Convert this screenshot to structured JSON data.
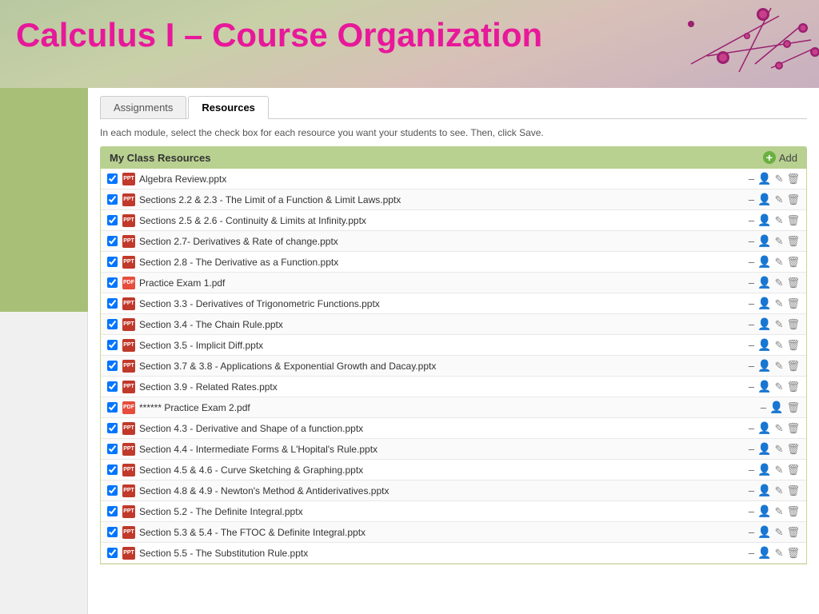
{
  "header": {
    "title": "Calculus I – Course Organization",
    "bg_color": "#c8d090"
  },
  "tabs": [
    {
      "id": "assignments",
      "label": "Assignments",
      "active": false
    },
    {
      "id": "resources",
      "label": "Resources",
      "active": true
    }
  ],
  "instruction": "In each module, select the check box for each resource you want your students to see. Then, click Save.",
  "resources_section": {
    "header": "My Class Resources",
    "add_label": "Add"
  },
  "resources": [
    {
      "name": "Algebra Review.pptx",
      "type": "pptx",
      "has_person": true
    },
    {
      "name": "Sections 2.2 & 2.3 - The Limit of a Function & Limit Laws.pptx",
      "type": "pptx",
      "has_person": true
    },
    {
      "name": "Sections 2.5 & 2.6 - Continuity & Limits at Infinity.pptx",
      "type": "pptx",
      "has_person": true
    },
    {
      "name": "Section 2.7- Derivatives & Rate of change.pptx",
      "type": "pptx",
      "has_person": true
    },
    {
      "name": "Section 2.8 - The Derivative as a Function.pptx",
      "type": "pptx",
      "has_person": true
    },
    {
      "name": "Practice Exam 1.pdf",
      "type": "pdf",
      "has_person": true
    },
    {
      "name": "Section 3.3 - Derivatives of Trigonometric Functions.pptx",
      "type": "pptx",
      "has_person": true
    },
    {
      "name": "Section 3.4 - The Chain Rule.pptx",
      "type": "pptx",
      "has_person": true
    },
    {
      "name": "Section 3.5 - Implicit Diff.pptx",
      "type": "pptx",
      "has_person": true
    },
    {
      "name": "Section 3.7 & 3.8 - Applications & Exponential Growth and Dacay.pptx",
      "type": "pptx",
      "has_person": true
    },
    {
      "name": "Section 3.9 - Related Rates.pptx",
      "type": "pptx",
      "has_person": true
    },
    {
      "name": "****** Practice Exam 2.pdf",
      "type": "pdf",
      "has_person": true
    },
    {
      "name": "Section 4.3 - Derivative and Shape of a function.pptx",
      "type": "pptx",
      "has_person": true
    },
    {
      "name": "Section 4.4 - Intermediate Forms & L'Hopital's Rule.pptx",
      "type": "pptx",
      "has_person": true
    },
    {
      "name": "Section 4.5 & 4.6 - Curve Sketching & Graphing.pptx",
      "type": "pptx",
      "has_person": true
    },
    {
      "name": "Section 4.8 & 4.9 - Newton's Method & Antiderivatives.pptx",
      "type": "pptx",
      "has_person": true
    },
    {
      "name": "Section 5.2 - The Definite Integral.pptx",
      "type": "pptx",
      "has_person": true
    },
    {
      "name": "Section 5.3 & 5.4 - The FTOC & Definite Integral.pptx",
      "type": "pptx",
      "has_person": true
    },
    {
      "name": "Section 5.5 - The Substitution Rule.pptx",
      "type": "pptx",
      "has_person": true
    }
  ]
}
